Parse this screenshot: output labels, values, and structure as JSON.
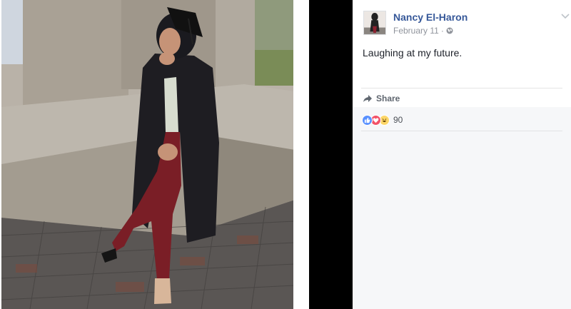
{
  "post": {
    "author": "Nancy El-Haron",
    "date": "February 11",
    "separator": "·",
    "privacy_icon": "globe-icon",
    "text": "Laughing at my future.",
    "menu_icon": "chevron-down-icon"
  },
  "actions": {
    "share_label": "Share",
    "share_icon": "share-arrow-icon"
  },
  "reactions": {
    "types": [
      "like",
      "love",
      "haha"
    ],
    "count": "90"
  },
  "colors": {
    "author_link": "#365899",
    "like": "#5890ff",
    "love": "#f25268",
    "haha": "#fcd669"
  }
}
